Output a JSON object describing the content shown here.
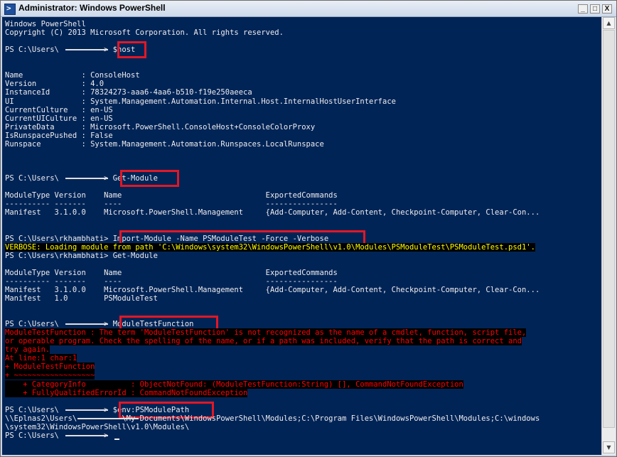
{
  "window": {
    "title": "Administrator: Windows PowerShell",
    "icon": "powershell-icon",
    "controls": {
      "minimize": "_",
      "maximize": "□",
      "close": "X"
    }
  },
  "colors": {
    "console_bg": "#012456",
    "console_fg": "#EEEDF0",
    "verbose_fg": "#FFFF00",
    "error_fg": "#FF0000",
    "highlight_box": "#E01826"
  },
  "console": {
    "lines": [
      {
        "id": "banner1",
        "kind": "normal",
        "text": "Windows PowerShell"
      },
      {
        "id": "banner2",
        "kind": "normal",
        "text": "Copyright (C) 2013 Microsoft Corporation. All rights reserved."
      },
      {
        "id": "p1",
        "kind": "prompt",
        "text": "PS C:\\Users\\          > $host"
      },
      {
        "id": "h1",
        "kind": "normal",
        "text": "Name             : ConsoleHost"
      },
      {
        "id": "h2",
        "kind": "normal",
        "text": "Version          : 4.0"
      },
      {
        "id": "h3",
        "kind": "normal",
        "text": "InstanceId       : 78324273-aaa6-4aa6-b510-f19e250aeeca"
      },
      {
        "id": "h4",
        "kind": "normal",
        "text": "UI               : System.Management.Automation.Internal.Host.InternalHostUserInterface"
      },
      {
        "id": "h5",
        "kind": "normal",
        "text": "CurrentCulture   : en-US"
      },
      {
        "id": "h6",
        "kind": "normal",
        "text": "CurrentUICulture : en-US"
      },
      {
        "id": "h7",
        "kind": "normal",
        "text": "PrivateData      : Microsoft.PowerShell.ConsoleHost+ConsoleColorProxy"
      },
      {
        "id": "h8",
        "kind": "normal",
        "text": "IsRunspacePushed : False"
      },
      {
        "id": "h9",
        "kind": "normal",
        "text": "Runspace         : System.Management.Automation.Runspaces.LocalRunspace"
      },
      {
        "id": "p2",
        "kind": "prompt",
        "text": "PS C:\\Users\\          > Get-Module"
      },
      {
        "id": "m1",
        "kind": "normal",
        "text": "ModuleType Version    Name                                ExportedCommands"
      },
      {
        "id": "m2",
        "kind": "normal",
        "text": "---------- -------    ----                                ----------------"
      },
      {
        "id": "m3",
        "kind": "normal",
        "text": "Manifest   3.1.0.0    Microsoft.PowerShell.Management     {Add-Computer, Add-Content, Checkpoint-Computer, Clear-Con..."
      },
      {
        "id": "p3",
        "kind": "prompt",
        "text": "PS C:\\Users\\rkhambhati> Import-Module -Name PSModuleTest -Force -Verbose"
      },
      {
        "id": "v1",
        "kind": "verbose",
        "text": "VERBOSE: Loading module from path 'C:\\Windows\\system32\\WindowsPowerShell\\v1.0\\Modules\\PSModuleTest\\PSModuleTest.psd1'."
      },
      {
        "id": "p4",
        "kind": "prompt",
        "text": "PS C:\\Users\\rkhambhati> Get-Module"
      },
      {
        "id": "n1",
        "kind": "normal",
        "text": "ModuleType Version    Name                                ExportedCommands"
      },
      {
        "id": "n2",
        "kind": "normal",
        "text": "---------- -------    ----                                ----------------"
      },
      {
        "id": "n3",
        "kind": "normal",
        "text": "Manifest   3.1.0.0    Microsoft.PowerShell.Management     {Add-Computer, Add-Content, Checkpoint-Computer, Clear-Con..."
      },
      {
        "id": "n4",
        "kind": "normal",
        "text": "Manifest   1.0        PSModuleTest"
      },
      {
        "id": "p5",
        "kind": "prompt",
        "text": "PS C:\\Users\\          > ModuleTestFunction"
      },
      {
        "id": "e1",
        "kind": "error",
        "text": "ModuleTestFunction : The term 'ModuleTestFunction' is not recognized as the name of a cmdlet, function, script file,"
      },
      {
        "id": "e2",
        "kind": "error",
        "text": "or operable program. Check the spelling of the name, or if a path was included, verify that the path is correct and"
      },
      {
        "id": "e3",
        "kind": "error",
        "text": "try again."
      },
      {
        "id": "e4",
        "kind": "error",
        "text": "At line:1 char:1"
      },
      {
        "id": "e5",
        "kind": "error",
        "text": "+ ModuleTestFunction"
      },
      {
        "id": "e6",
        "kind": "error",
        "text": "+ ~~~~~~~~~~~~~~~~~~"
      },
      {
        "id": "e7",
        "kind": "error",
        "text": "    + CategoryInfo          : ObjectNotFound: (ModuleTestFunction:String) [], CommandNotFoundException"
      },
      {
        "id": "e8",
        "kind": "error",
        "text": "    + FullyQualifiedErrorId : CommandNotFoundException"
      },
      {
        "id": "p6",
        "kind": "prompt",
        "text": "PS C:\\Users\\          > $env:PSModulePath"
      },
      {
        "id": "o1",
        "kind": "normal",
        "text": "\\\\Eplnas2\\Users\\          \\My Documents\\WindowsPowerShell\\Modules;C:\\Program Files\\WindowsPowerShell\\Modules;C:\\windows"
      },
      {
        "id": "o2",
        "kind": "normal",
        "text": "\\system32\\WindowsPowerShell\\v1.0\\Modules\\"
      },
      {
        "id": "p7",
        "kind": "prompt",
        "text": "PS C:\\Users\\          > "
      }
    ]
  }
}
